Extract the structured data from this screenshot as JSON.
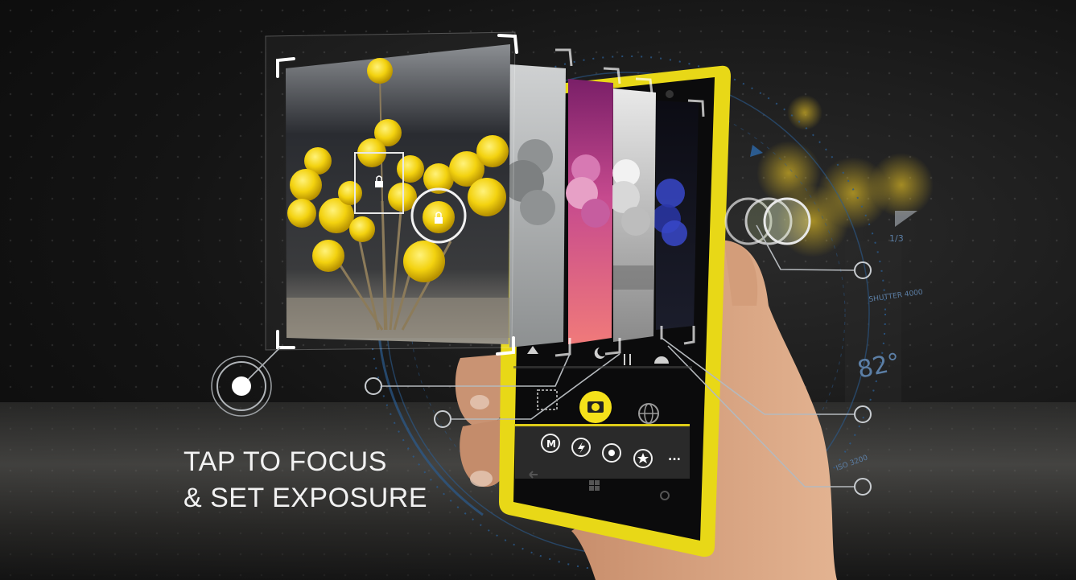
{
  "headline": {
    "line1": "TAP TO FOCUS",
    "line2": "& SET EXPOSURE"
  },
  "hud": {
    "temperature": "82°",
    "shutter_label": "SHUTTER 4000",
    "iso_label": "ISO 3200",
    "fraction_label": "1/3"
  },
  "camera_ui": {
    "mode_button": "M",
    "more_button": "...",
    "scene_icons": [
      "landscape-icon",
      "night-icon",
      "food-icon",
      "sunset-icon"
    ],
    "bottom_icons": [
      "manual-mode-icon",
      "flash-icon",
      "lens-icon",
      "favorite-icon",
      "more-icon"
    ],
    "main_icons": [
      "crop-frame-icon",
      "shutter-icon",
      "globe-icon"
    ]
  },
  "colors": {
    "accent_yellow": "#f5e11a",
    "phone_body": "#e8d817",
    "hud_line": "#9aa0a6",
    "hud_blue": "#2b5b8f"
  }
}
